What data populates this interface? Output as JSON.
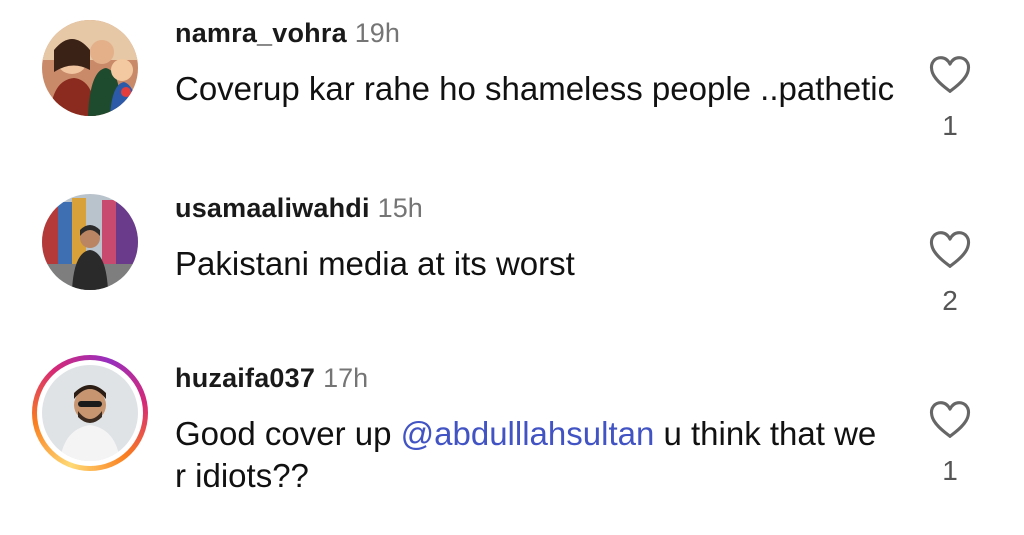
{
  "comments": [
    {
      "username": "namra_vohra",
      "time": "19h",
      "text": "Coverup kar rahe ho shameless people ..pathetic",
      "likes": "1",
      "has_story_ring": false
    },
    {
      "username": "usamaaliwahdi",
      "time": "15h",
      "text": "Pakistani media at its worst",
      "likes": "2",
      "has_story_ring": false
    },
    {
      "username": "huzaifa037",
      "time": "17h",
      "text_before": "Good cover up ",
      "mention": "@abdulllahsultan",
      "text_after": " u think that we r idiots??",
      "likes": "1",
      "has_story_ring": true
    }
  ],
  "colors": {
    "mention": "#4254c4",
    "timestamp": "#757575",
    "story_ring": [
      "#feda75",
      "#fa7e1e",
      "#d62976",
      "#962fbf"
    ]
  },
  "icons": {
    "like": "heart-outline-icon"
  }
}
